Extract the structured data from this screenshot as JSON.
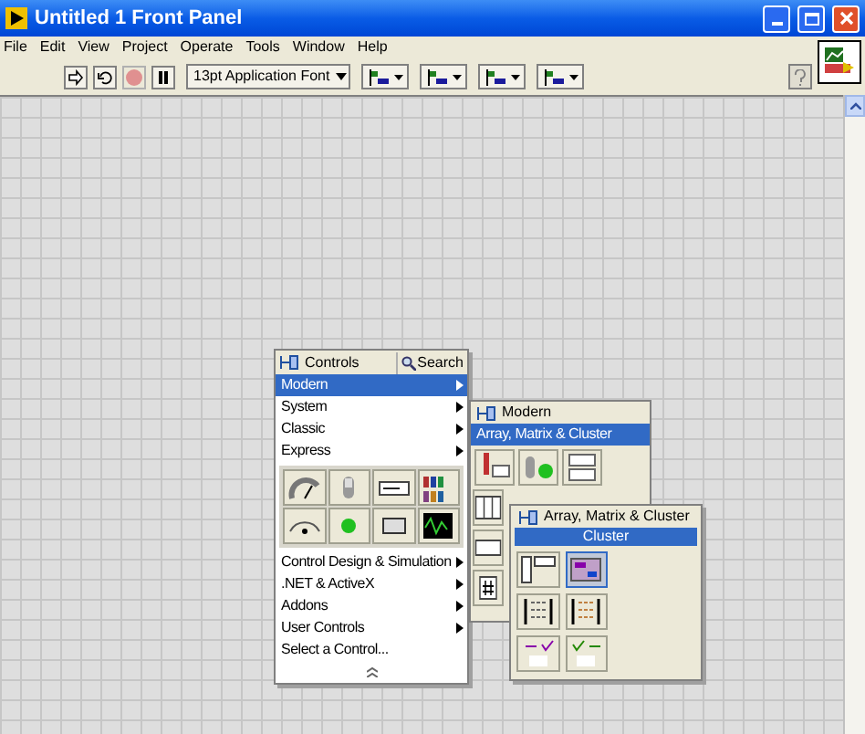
{
  "window": {
    "title": "Untitled 1 Front Panel"
  },
  "menu": [
    "File",
    "Edit",
    "View",
    "Project",
    "Operate",
    "Tools",
    "Window",
    "Help"
  ],
  "toolbar": {
    "font": "13pt Application Font"
  },
  "controls_palette": {
    "title": "Controls",
    "search": "Search",
    "items": [
      {
        "label": "Modern",
        "selected": true,
        "submenu": true
      },
      {
        "label": "System",
        "selected": false,
        "submenu": true
      },
      {
        "label": "Classic",
        "selected": false,
        "submenu": true
      },
      {
        "label": "Express",
        "selected": false,
        "submenu": true
      },
      {
        "kind": "icons"
      },
      {
        "label": "Control Design & Simulation",
        "selected": false,
        "submenu": true
      },
      {
        "label": ".NET & ActiveX",
        "selected": false,
        "submenu": true
      },
      {
        "label": "Addons",
        "selected": false,
        "submenu": true
      },
      {
        "label": "User Controls",
        "selected": false,
        "submenu": true
      },
      {
        "label": "Select a Control...",
        "selected": false,
        "submenu": false
      }
    ]
  },
  "modern_palette": {
    "title": "Modern",
    "items": [
      {
        "label": "Array, Matrix & Cluster",
        "selected": true
      }
    ]
  },
  "array_palette": {
    "title": "Array, Matrix & Cluster",
    "items": [
      {
        "label": "Cluster",
        "selected": true
      }
    ]
  }
}
